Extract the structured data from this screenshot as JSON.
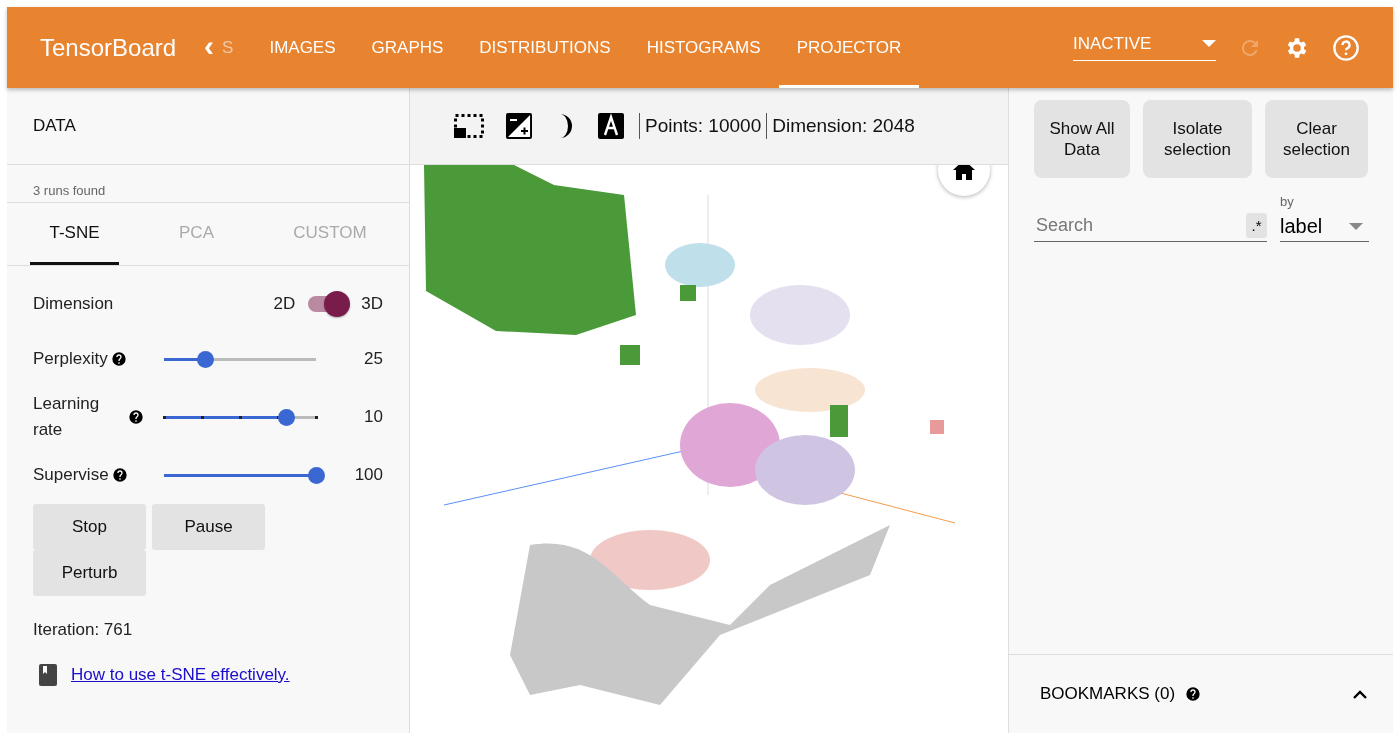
{
  "header": {
    "title": "TensorBoard",
    "back": "‹",
    "tabs": [
      {
        "label": "S",
        "selected": false
      },
      {
        "label": "IMAGES",
        "selected": false
      },
      {
        "label": "GRAPHS",
        "selected": false
      },
      {
        "label": "DISTRIBUTIONS",
        "selected": false
      },
      {
        "label": "HISTOGRAMS",
        "selected": false
      },
      {
        "label": "PROJECTOR",
        "selected": true
      }
    ],
    "run_select": {
      "value": "INACTIVE"
    },
    "reload_disabled": true
  },
  "left_panel": {
    "title": "DATA",
    "runs_found": "3 runs found",
    "tabs": [
      {
        "label": "T-SNE",
        "selected": true
      },
      {
        "label": "PCA",
        "selected": false
      },
      {
        "label": "CUSTOM",
        "selected": false
      }
    ],
    "dimension": {
      "label": "Dimension",
      "off_label": "2D",
      "on_label": "3D",
      "on": true
    },
    "sliders": [
      {
        "label": "Perplexity",
        "level": 0.27,
        "reading": "25",
        "ticks": false
      },
      {
        "label": "Learning rate",
        "level": 0.8,
        "reading": "10",
        "ticks": true
      },
      {
        "label": "Supervise",
        "level": 1.0,
        "reading": "100",
        "ticks": false
      }
    ],
    "buttons": [
      "Stop",
      "Pause",
      "Perturb"
    ],
    "iteration": "Iteration: 761",
    "link": "How to use t-SNE effectively."
  },
  "toolbar": {
    "points": "Points: 10000",
    "dimension": "Dimension: 2048"
  },
  "right_panel": {
    "buttons": [
      "Show All Data",
      "Isolate selection",
      "Clear selection"
    ],
    "search": {
      "placeholder": "Search",
      "regex": ".*"
    },
    "color_by": {
      "label": "by",
      "value": "label"
    },
    "bookmarks": {
      "label": "BOOKMARKS (0)",
      "expanded": true
    }
  }
}
